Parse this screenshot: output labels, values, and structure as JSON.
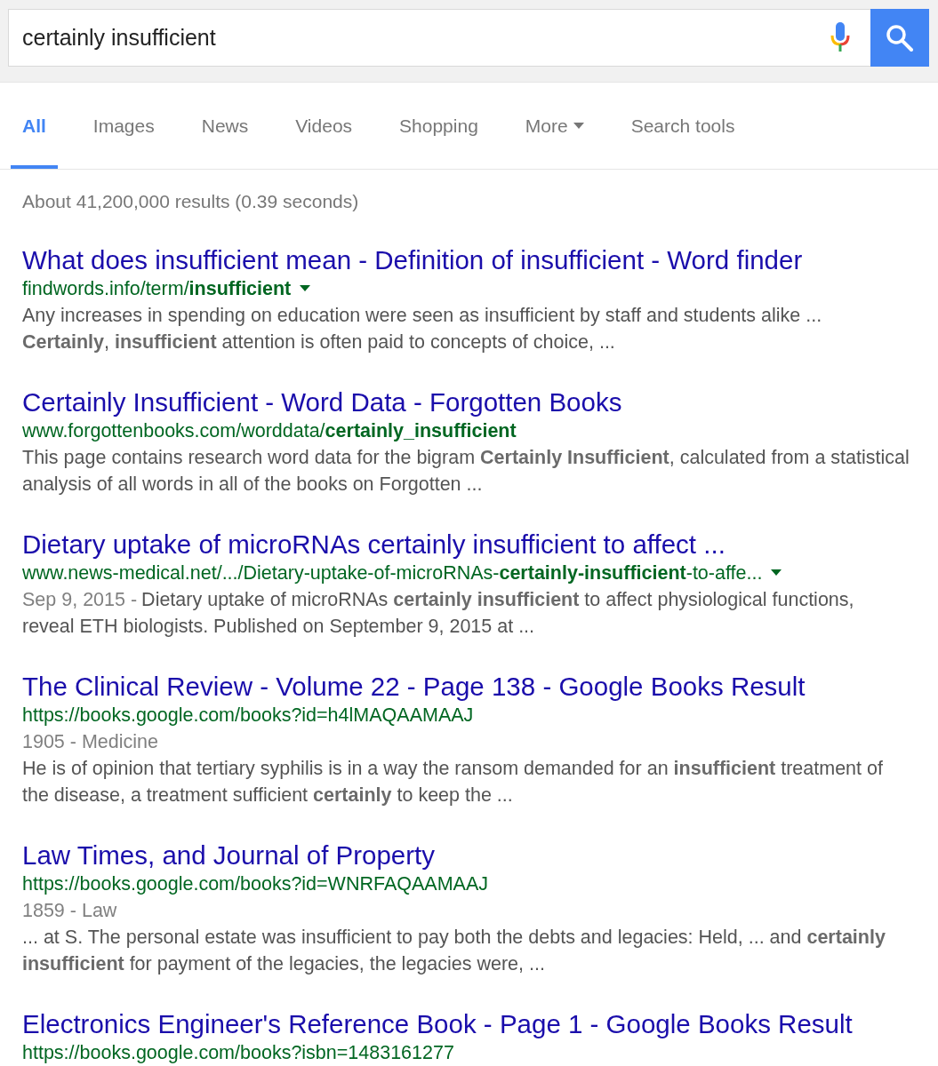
{
  "search": {
    "value": "certainly insufficient"
  },
  "tabs": [
    {
      "label": "All",
      "selected": true,
      "has_menu": false
    },
    {
      "label": "Images",
      "selected": false,
      "has_menu": false
    },
    {
      "label": "News",
      "selected": false,
      "has_menu": false
    },
    {
      "label": "Videos",
      "selected": false,
      "has_menu": false
    },
    {
      "label": "Shopping",
      "selected": false,
      "has_menu": false
    },
    {
      "label": "More",
      "selected": false,
      "has_menu": true
    }
  ],
  "search_tools": "Search tools",
  "result_stats": "About 41,200,000 results (0.39 seconds)",
  "results": [
    {
      "title": "What does insufficient mean - Definition of insufficient - Word finder",
      "url": "findwords.info/term/**insufficient**",
      "has_menu": true,
      "snippet": "Any increases in spending on education were seen as insufficient by staff and students alike ... **Certainly**, **insufficient** attention is often paid to concepts of choice, ..."
    },
    {
      "title": "Certainly Insufficient - Word Data - Forgotten Books",
      "url": "www.forgottenbooks.com/worddata/**certainly_insufficient**",
      "has_menu": false,
      "snippet": "This page contains research word data for the bigram **Certainly Insufficient**, calculated from a statistical analysis of all words in all of the books on Forgotten ..."
    },
    {
      "title": "Dietary uptake of microRNAs certainly insufficient to affect ...",
      "url": "www.news-medical.net/.../Dietary-uptake-of-microRNAs-**certainly-insufficient**-to-affe...",
      "has_menu": true,
      "date": "Sep 9, 2015 -",
      "snippet": "Dietary uptake of microRNAs **certainly** **insufficient** to affect physiological functions, reveal ETH biologists. Published on September 9, 2015 at ..."
    },
    {
      "title": "The Clinical Review - Volume 22 - Page 138 - Google Books Result",
      "url": "https://books.google.com/books?id=h4lMAQAAMAAJ",
      "has_menu": false,
      "meta": "1905 - Medicine",
      "snippet": "He is of opinion that tertiary syphilis is in a way the ransom demanded for an **insufficient** treatment of the disease, a treatment sufficient **certainly** to keep the ..."
    },
    {
      "title": "Law Times, and Journal of Property",
      "url": "https://books.google.com/books?id=WNRFAQAAMAAJ",
      "has_menu": false,
      "meta": "1859 - Law",
      "snippet": "... at S. The personal estate was insufficient to pay both the debts and legacies: Held, ... and **certainly** **insufficient** for payment of the legacies, the legacies were, ..."
    },
    {
      "title": "Electronics Engineer's Reference Book - Page 1 - Google Books Result",
      "url": "https://books.google.com/books?isbn=1483161277",
      "has_menu": false
    }
  ]
}
